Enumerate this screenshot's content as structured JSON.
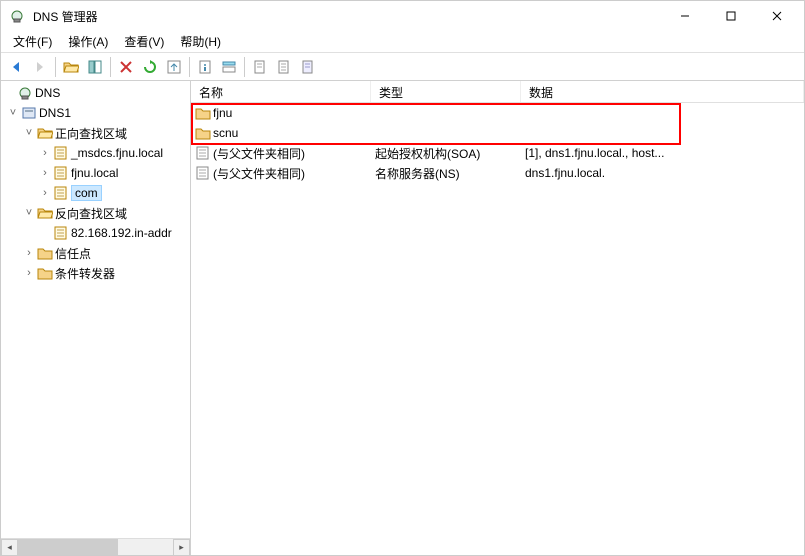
{
  "window": {
    "title": "DNS 管理器"
  },
  "menu": {
    "file": "文件(F)",
    "action": "操作(A)",
    "view": "查看(V)",
    "help": "帮助(H)"
  },
  "tree": {
    "root": "DNS",
    "server": "DNS1",
    "fwd_zone": "正向查找区域",
    "zone_msdcs": "_msdcs.fjnu.local",
    "zone_fjnu": "fjnu.local",
    "zone_com": "com",
    "rev_zone": "反向查找区域",
    "zone_rev1": "82.168.192.in-addr",
    "trust_points": "信任点",
    "cond_fwd": "条件转发器"
  },
  "columns": {
    "name": "名称",
    "type": "类型",
    "data": "数据"
  },
  "rows": [
    {
      "icon": "folder",
      "name": "fjnu",
      "type": "",
      "data": ""
    },
    {
      "icon": "folder",
      "name": "scnu",
      "type": "",
      "data": ""
    },
    {
      "icon": "record",
      "name": "(与父文件夹相同)",
      "type": "起始授权机构(SOA)",
      "data": "[1], dns1.fjnu.local., host..."
    },
    {
      "icon": "record",
      "name": "(与父文件夹相同)",
      "type": "名称服务器(NS)",
      "data": "dns1.fjnu.local."
    }
  ]
}
